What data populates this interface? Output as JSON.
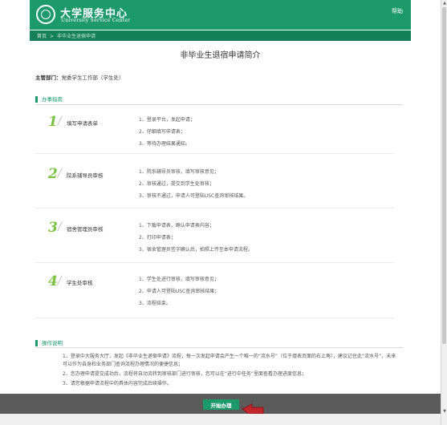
{
  "header": {
    "logo_title": "大学服务中心",
    "logo_subtitle": "University Service Center",
    "help": "帮助"
  },
  "breadcrumb": {
    "home": "首页",
    "separator": ">",
    "current": "非毕业生退宿申请"
  },
  "page_title": "非毕业生退宿申请简介",
  "department": {
    "label": "主管部门：",
    "value": "党委学生工作部（学生处）"
  },
  "guide": {
    "heading": "办事指南",
    "steps": [
      {
        "num": "1",
        "title": "填写申请表单",
        "items": [
          "1、登录平台，发起申请；",
          "2、仔细填写申请表；",
          "3、等待办理结果通知。"
        ]
      },
      {
        "num": "2",
        "title": "院系辅导员审核",
        "items": [
          "1、院系辅导员审核，填写审核意见；",
          "2、审核通过，提交到学生处审核；",
          "3、审核不通过，申请人可登陆USC查询审核结果。"
        ]
      },
      {
        "num": "3",
        "title": "宿舍管理员审核",
        "items": [
          "1、下载申请表，确认申请表内容；",
          "2、打印申请表；",
          "3、宿舍管理员签字确认后，拍照上传至本申请流程。"
        ]
      },
      {
        "num": "4",
        "title": "学生处审核",
        "items": [
          "1、学生处进行审核，填写审核意见；",
          "2、申请人可登陆USC查询审核结果；",
          "3、流程结束。"
        ]
      }
    ]
  },
  "notes": {
    "heading": "操作说明",
    "items": [
      "1、登录中大服务大厅，发起《非毕业生退宿申请》流程，每一次发起申请会产生一个唯一的“流水号”（位于填表页面的右上角），建议记住此“流水号”，未来可以作为自身和业务部门查询流程办理情况的便捷信息；",
      "2、您办理申请提交成功后，流程将自动流转到审核部门进行审核，您可以在“进行中任务”里面查看办理进度信息；",
      "3、请您根据申请流程中的具体内容完成后续操作。"
    ]
  },
  "footer": {
    "start_button": "开始办理"
  },
  "colors": {
    "brand_green": "#1d9a6c",
    "step_number": "#7bc143",
    "arrow_red": "#c0262b",
    "footer_bar": "#5b5b5b"
  }
}
